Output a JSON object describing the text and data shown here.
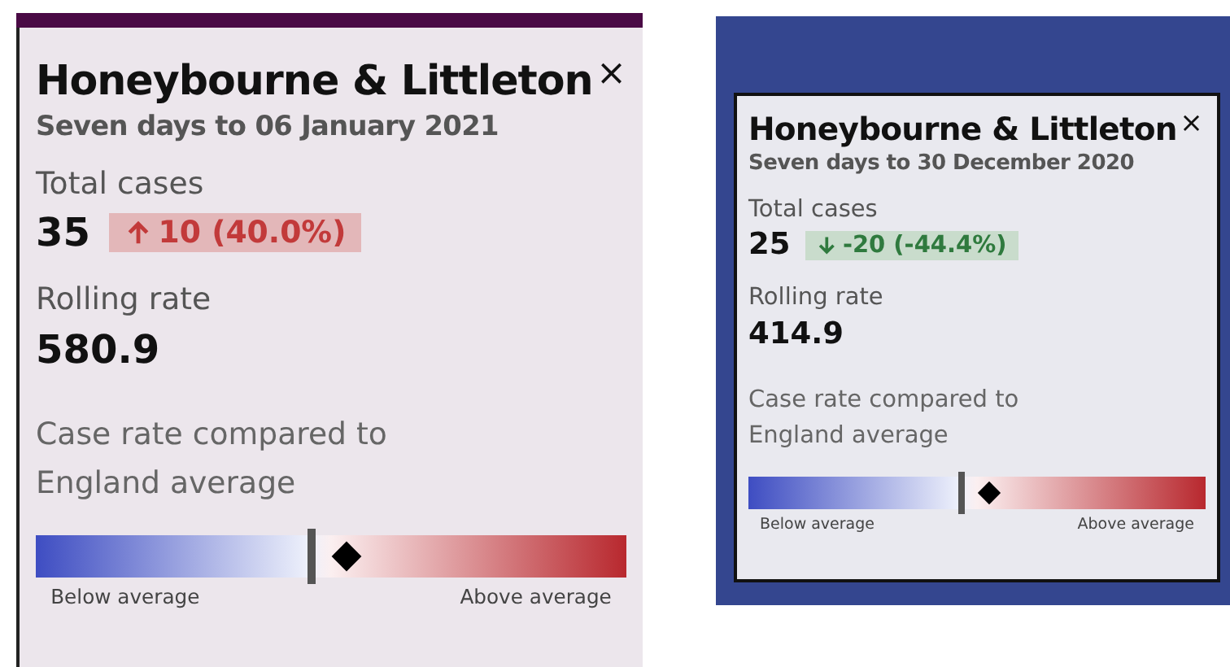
{
  "panels": [
    {
      "title": "Honeybourne & Littleton",
      "close": "×",
      "subtitle": "Seven days to 06 January 2021",
      "total_label": "Total cases",
      "total": "35",
      "change": {
        "increase": true,
        "text": "10 (40.0%)"
      },
      "rate_label": "Rolling rate",
      "rate": "580.9",
      "compare_label": "Case rate compared to England average",
      "scale": {
        "level": 0.525,
        "low": "Below average",
        "high": "Above average"
      }
    },
    {
      "title": "Honeybourne & Littleton",
      "close": "×",
      "subtitle": "Seven days to 30 December 2020",
      "total_label": "Total cases",
      "total": "25",
      "change": {
        "increase": false,
        "text": "-20 (-44.4%)"
      },
      "rate_label": "Rolling rate",
      "rate": "414.9",
      "compare_label": "Case rate compared to England average",
      "scale": {
        "level": 0.525,
        "low": "Below average",
        "high": "Above average"
      }
    }
  ]
}
